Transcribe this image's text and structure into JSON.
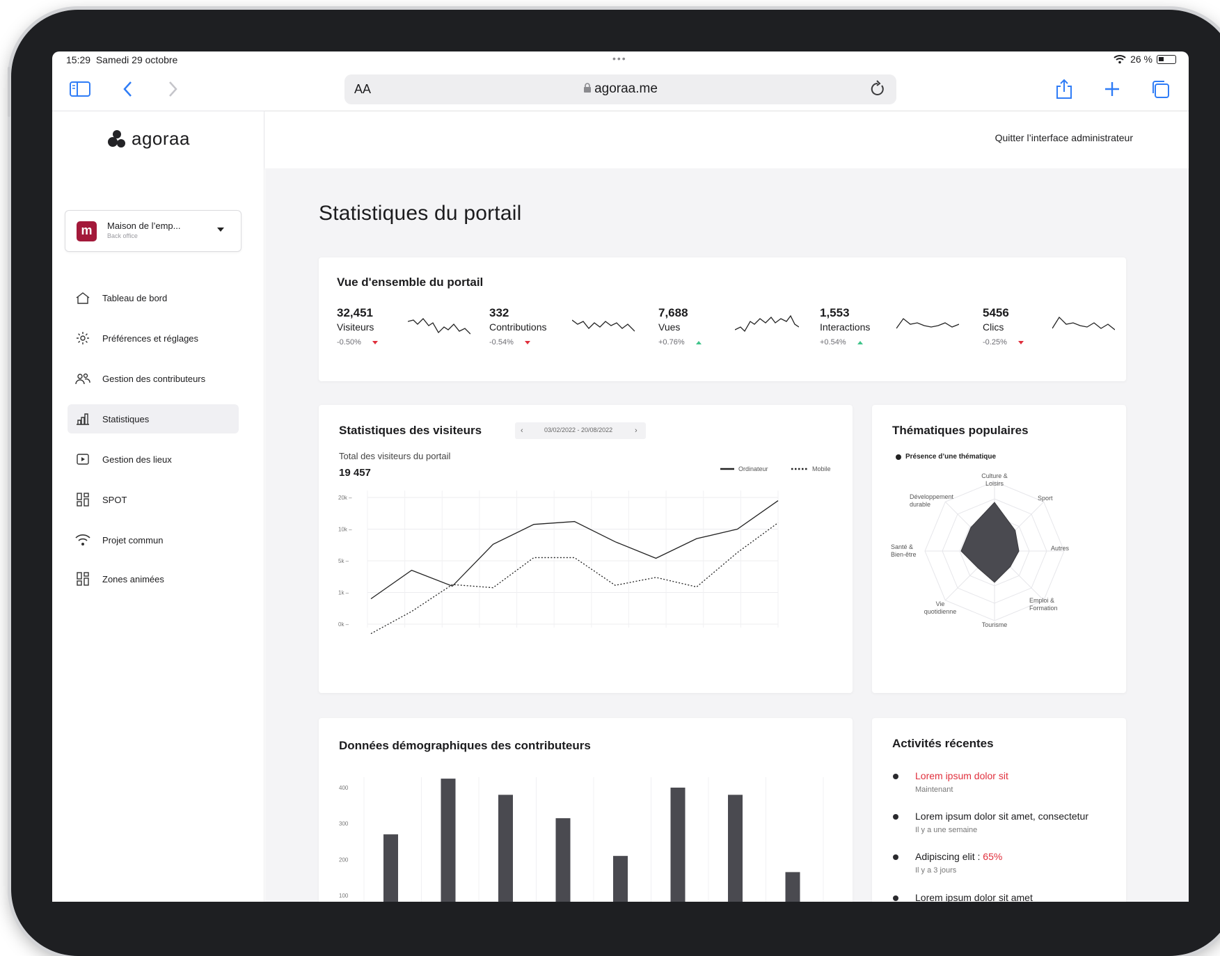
{
  "status": {
    "time": "15:29",
    "date": "Samedi 29 octobre",
    "battery": "26 %"
  },
  "browser": {
    "reader_label": "AA",
    "url": "agoraa.me"
  },
  "app": {
    "logo": "agoraa",
    "quit_label": "Quitter l’interface administrateur",
    "org": {
      "name": "Maison de l’emp...",
      "sub": "Back office",
      "initial": "m"
    },
    "nav": [
      {
        "label": "Tableau de bord",
        "icon": "home-icon"
      },
      {
        "label": "Préférences et réglages",
        "icon": "gear-icon"
      },
      {
        "label": "Gestion des contributeurs",
        "icon": "users-icon"
      },
      {
        "label": "Statistiques",
        "icon": "bar-chart-icon",
        "active": true
      },
      {
        "label": "Gestion des lieux",
        "icon": "place-icon"
      },
      {
        "label": "SPOT",
        "icon": "grid-icon"
      },
      {
        "label": "Projet commun",
        "icon": "wifi-icon"
      },
      {
        "label": "Zones animées",
        "icon": "grid-icon"
      }
    ]
  },
  "page": {
    "title": "Statistiques du portail"
  },
  "overview": {
    "title": "Vue d'ensemble du portail",
    "metrics": [
      {
        "value": "32,451",
        "label": "Visiteurs",
        "change": "-0.50%",
        "trend": "down"
      },
      {
        "value": "332",
        "label": "Contributions",
        "change": "-0.54%",
        "trend": "down"
      },
      {
        "value": "7,688",
        "label": "Vues",
        "change": "+0.76%",
        "trend": "up"
      },
      {
        "value": "1,553",
        "label": "Interactions",
        "change": "+0.54%",
        "trend": "up"
      },
      {
        "value": "5456",
        "label": "Clics",
        "change": "-0.25%",
        "trend": "down"
      }
    ]
  },
  "visitors": {
    "title": "Statistiques des visiteurs",
    "date_range": "03/02/2022 - 20/08/2022",
    "subtitle": "Total des visiteurs du portail",
    "total": "19 457"
  },
  "themes": {
    "title": "Thématiques populaires",
    "legend": "Présence d’une thématique"
  },
  "demo": {
    "title": "Données démographiques des contributeurs"
  },
  "activities": {
    "title": "Activités récentes",
    "items": [
      {
        "text": "Lorem ipsum dolor sit",
        "time": "Maintenant",
        "accent": true
      },
      {
        "text": "Lorem ipsum dolor sit amet, consectetur",
        "time": "Il y a une semaine"
      },
      {
        "text": "Adipiscing elit : ",
        "highlight": "65%",
        "time": "Il y a 3 jours"
      },
      {
        "text": "Lorem ipsum dolor sit amet",
        "time": ""
      }
    ]
  },
  "colors": {
    "accent": "#e02f3c",
    "ios_blue": "#2f7cf6",
    "bar": "#4a4a50",
    "brand": "#a3193a"
  },
  "chart_data": [
    {
      "type": "line",
      "title": "Statistiques des visiteurs",
      "y_ticks": [
        "0k",
        "1k",
        "5k",
        "10k",
        "20k"
      ],
      "series": [
        {
          "name": "Ordinateur",
          "style": "solid",
          "values": [
            0.8,
            3.8,
            1.8,
            7.6,
            11.5,
            12.4,
            8.0,
            5.4,
            8.5,
            10.0,
            19.0
          ]
        },
        {
          "name": "Mobile",
          "style": "dotted",
          "values": [
            -0.3,
            0.4,
            2.0,
            1.6,
            5.5,
            5.5,
            1.9,
            2.9,
            1.7,
            6.3,
            12.0
          ]
        }
      ]
    },
    {
      "type": "radar",
      "title": "Thématiques populaires",
      "axes": [
        "Culture & Loisirs",
        "Sport",
        "Autres",
        "Emploi & Formation",
        "Tourisme",
        "Vie quotidienne",
        "Santé & Bien-être",
        "Développement durable"
      ],
      "series": [
        {
          "name": "Présence d’une thématique",
          "values": [
            0.7,
            0.42,
            0.35,
            0.32,
            0.45,
            0.34,
            0.48,
            0.48
          ]
        }
      ]
    },
    {
      "type": "bar",
      "title": "Données démographiques des contributeurs",
      "y_ticks": [
        "100",
        "200",
        "300",
        "400"
      ],
      "ylim": [
        100,
        400
      ],
      "values": [
        270,
        425,
        380,
        315,
        210,
        400,
        380,
        165
      ]
    }
  ]
}
